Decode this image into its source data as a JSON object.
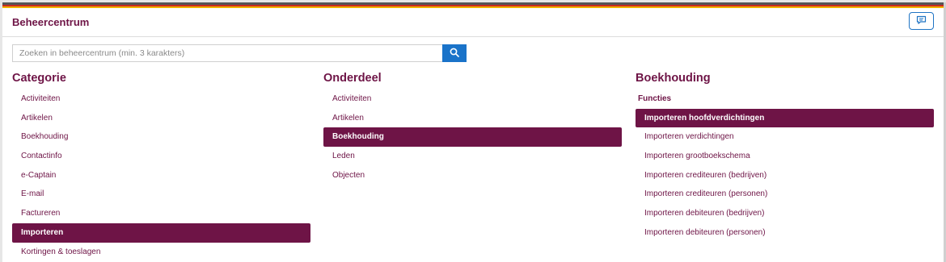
{
  "header": {
    "title": "Beheercentrum"
  },
  "search": {
    "placeholder": "Zoeken in beheercentrum (min. 3 karakters)"
  },
  "columns": {
    "categorie": {
      "title": "Categorie",
      "items": [
        "Activiteiten",
        "Artikelen",
        "Boekhouding",
        "Contactinfo",
        "e-Captain",
        "E-mail",
        "Factureren",
        "Importeren",
        "Kortingen & toeslagen"
      ],
      "active": "Importeren"
    },
    "onderdeel": {
      "title": "Onderdeel",
      "items": [
        "Activiteiten",
        "Artikelen",
        "Boekhouding",
        "Leden",
        "Objecten"
      ],
      "active": "Boekhouding"
    },
    "boekhouding": {
      "title": "Boekhouding",
      "subheading": "Functies",
      "items": [
        "Importeren hoofdverdichtingen",
        "Importeren verdichtingen",
        "Importeren grootboekschema",
        "Importeren crediteuren (bedrijven)",
        "Importeren crediteuren (personen)",
        "Importeren debiteuren (bedrijven)",
        "Importeren debiteuren (personen)"
      ],
      "active": "Importeren hoofdverdichtingen"
    }
  },
  "colors": {
    "accent": "#6e1446",
    "primary": "#1a73c9"
  },
  "icons": {
    "feedback": "comment-icon",
    "search": "search-icon"
  }
}
